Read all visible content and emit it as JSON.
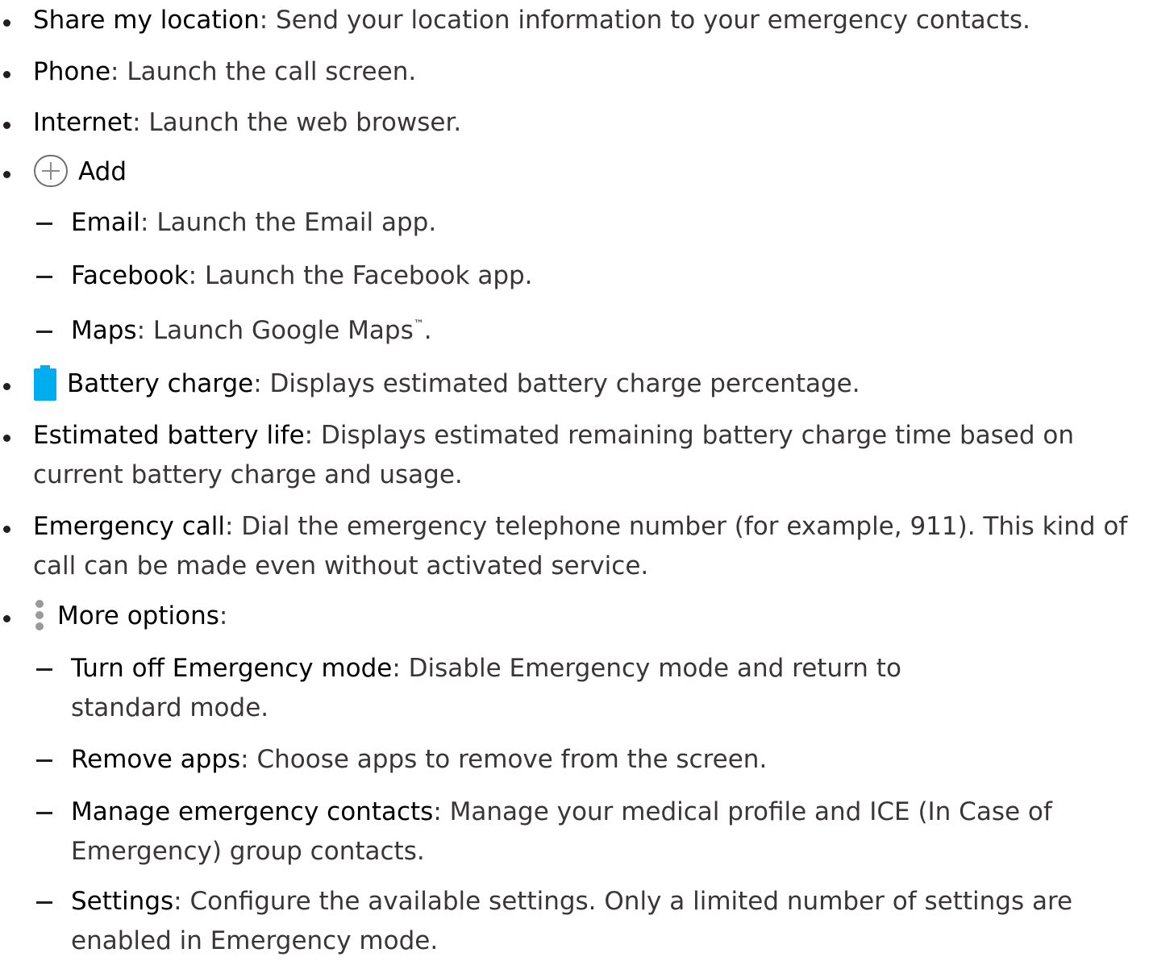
{
  "items": {
    "share_location": {
      "term": "Share my location",
      "desc": ": Send your location information to your emergency contacts."
    },
    "phone": {
      "term": "Phone",
      "desc": ": Launch the call screen."
    },
    "internet": {
      "term": "Internet",
      "desc": ": Launch the web browser."
    },
    "add": {
      "icon": "add-circle-icon",
      "term": "Add"
    },
    "email": {
      "term": "Email",
      "desc": ": Launch the Email app."
    },
    "facebook": {
      "term": "Facebook",
      "desc": ": Launch the Facebook app."
    },
    "maps": {
      "term": "Maps",
      "desc": ": Launch Google Maps",
      "tm": "™",
      "end": "."
    },
    "battery_charge": {
      "icon": "battery-icon",
      "term": "Battery charge",
      "desc": ": Displays estimated battery charge percentage."
    },
    "battery_life": {
      "term": "Estimated battery life",
      "desc": ": Displays estimated remaining battery charge time based on current battery charge and usage."
    },
    "emergency_call": {
      "term": "Emergency call",
      "desc": ": Dial the emergency telephone number (for example, 911). This kind of call can be made even without activated service."
    },
    "more_options": {
      "icon": "more-options-icon",
      "term": "More options",
      "desc": ":"
    },
    "turn_off": {
      "term": "Turn off Emergency mode",
      "desc": ": Disable Emergency mode and return to",
      "desc_line2": "standard mode."
    },
    "remove_apps": {
      "term": "Remove apps",
      "desc": ": Choose apps to remove from the screen."
    },
    "manage_contacts": {
      "term": "Manage emergency contacts",
      "desc": ": Manage your medical profile and ICE (In Case of Emergency) group contacts."
    },
    "settings": {
      "term": "Settings",
      "desc": ": Configure the available settings. Only a limited number of settings are enabled in Emergency mode."
    }
  },
  "colors": {
    "text": "#231f20",
    "battery": "#00aeef",
    "icon_gray": "#8c8c8c"
  }
}
